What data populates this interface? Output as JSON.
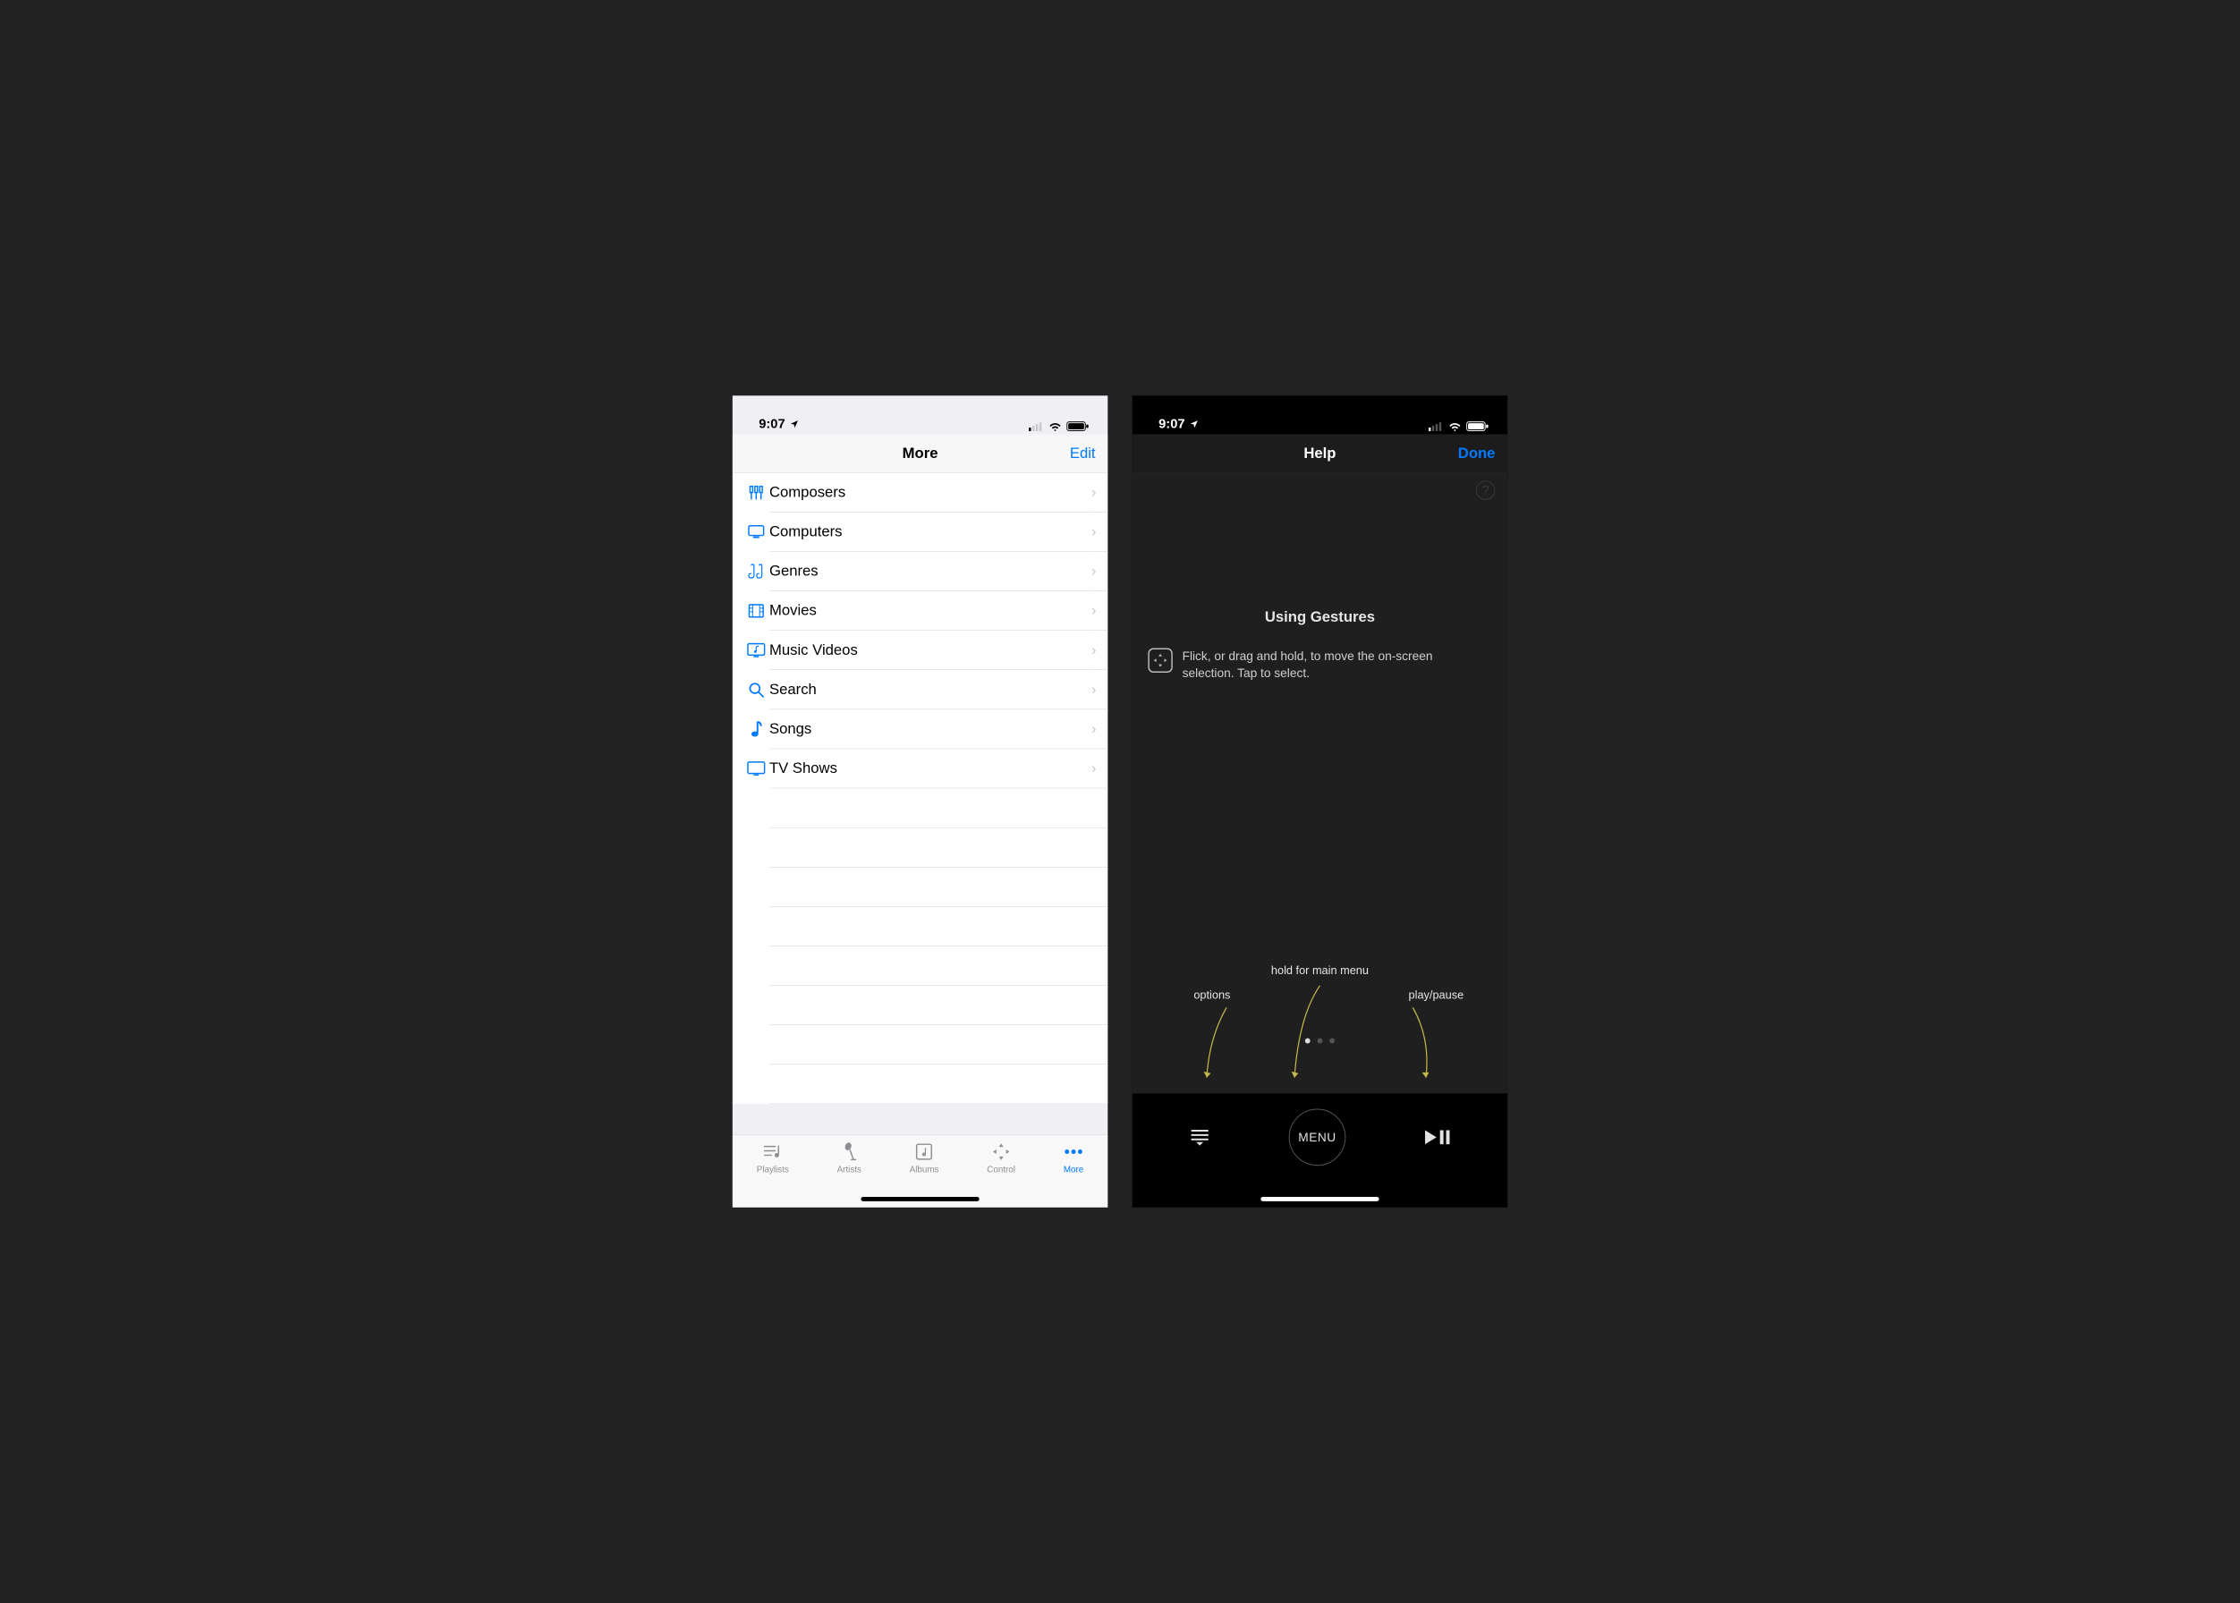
{
  "status": {
    "time": "9:07"
  },
  "left": {
    "nav_title": "More",
    "nav_right": "Edit",
    "rows": [
      {
        "icon": "composers",
        "label": "Composers"
      },
      {
        "icon": "computers",
        "label": "Computers"
      },
      {
        "icon": "genres",
        "label": "Genres"
      },
      {
        "icon": "movies",
        "label": "Movies"
      },
      {
        "icon": "musicvideos",
        "label": "Music Videos"
      },
      {
        "icon": "search",
        "label": "Search"
      },
      {
        "icon": "songs",
        "label": "Songs"
      },
      {
        "icon": "tvshows",
        "label": "TV Shows"
      }
    ],
    "tabs": [
      {
        "key": "playlists",
        "label": "Playlists",
        "active": false
      },
      {
        "key": "artists",
        "label": "Artists",
        "active": false
      },
      {
        "key": "albums",
        "label": "Albums",
        "active": false
      },
      {
        "key": "control",
        "label": "Control",
        "active": false
      },
      {
        "key": "more",
        "label": "More",
        "active": true
      }
    ]
  },
  "right": {
    "nav_title": "Help",
    "nav_right": "Done",
    "gesture_title": "Using Gestures",
    "gesture_text": "Flick, or drag and hold, to move the on-screen selection. Tap to select.",
    "hint_hold": "hold for main menu",
    "hint_options": "options",
    "hint_playpause": "play/pause",
    "page_dots": {
      "count": 3,
      "active": 0
    },
    "menu_button_label": "MENU"
  }
}
